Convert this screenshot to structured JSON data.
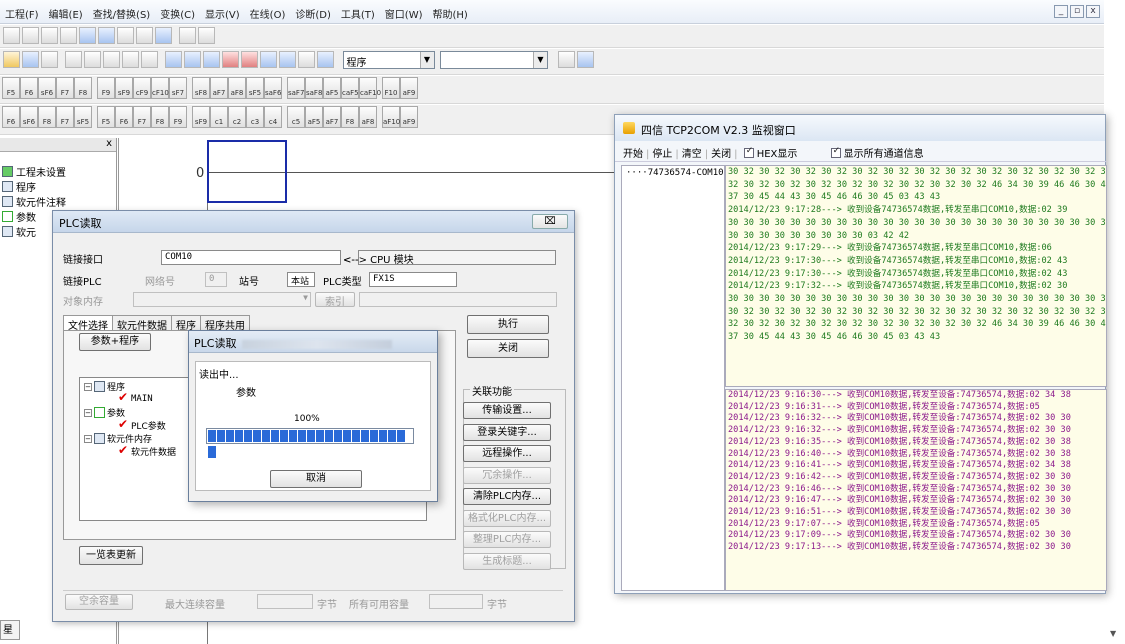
{
  "app": {
    "menu": [
      "工程(F)",
      "编辑(E)",
      "查找/替换(S)",
      "变换(C)",
      "显示(V)",
      "在线(O)",
      "诊断(D)",
      "工具(T)",
      "窗口(W)",
      "帮助(H)"
    ],
    "window_controls": [
      "_",
      "▫",
      "x"
    ],
    "combo_program": "程序",
    "combo_blank": "",
    "fkeys_row1": [
      "F5",
      "F6",
      "sF6",
      "F7",
      "F8",
      "F9",
      "sF9",
      "cF9",
      "cF10",
      "sF7",
      "sF8",
      "aF7",
      "aF8",
      "sF5",
      "saF6",
      "saF7",
      "saF8",
      "aF5",
      "caF5",
      "caF10",
      "F10",
      "aF9"
    ],
    "fkeys_row2": [
      "F6",
      "sF6",
      "F8",
      "F7",
      "sF5",
      "F5",
      "F6",
      "F7",
      "F8",
      "F9",
      "sF9",
      "c1",
      "c2",
      "c3",
      "c4",
      "c5",
      "aF5",
      "aF7",
      "F8",
      "aF8",
      "aF10",
      "aF9"
    ],
    "rung_step": "0",
    "bottom_tab": "星"
  },
  "left_panel": {
    "close_glyph": "x",
    "items": [
      {
        "label": "工程未设置"
      },
      {
        "label": "程序"
      },
      {
        "label": "软元件注释"
      },
      {
        "label": "参数"
      },
      {
        "label": "软元"
      }
    ]
  },
  "plc_dialog": {
    "title": "PLC读取",
    "close": "⌧",
    "link_interface_label": "链接接口",
    "link_interface_value": "COM10",
    "cpu_arrow": "<--> CPU 模块",
    "link_plc_label": "链接PLC",
    "network_label": "网络号",
    "network_value": "0",
    "station_label": "站号",
    "station_value": "本站",
    "plc_type_label": "PLC类型",
    "plc_type_value": "FX1S",
    "target_memory_label": "对象内存",
    "index_label": "索引",
    "tabs": [
      "文件选择",
      "软元件数据",
      "程序",
      "程序共用"
    ],
    "param_program_button": "参数+程序",
    "tree": {
      "program": "程序",
      "main": "MAIN",
      "params": "参数",
      "plc_params": "PLC参数",
      "device_memory": "软元件内存",
      "device_data": "软元件数据"
    },
    "list_update_button": "一览表更新",
    "execute_button": "执行",
    "close_button": "关闭",
    "related_title": "关联功能",
    "related_buttons": [
      "传输设置...",
      "登录关键字...",
      "远程操作...",
      "冗余操作...",
      "清除PLC内存...",
      "格式化PLC内存...",
      "整理PLC内存...",
      "生成标题..."
    ],
    "related_disabled": [
      false,
      false,
      false,
      true,
      false,
      true,
      true,
      true
    ],
    "free_capacity_button": "空余容量",
    "max_continuous_label": "最大连续容量",
    "bytes1": "字节",
    "all_available_label": "所有可用容量",
    "bytes2": "字节"
  },
  "progress_dialog": {
    "title": "PLC读取",
    "reading": "读出中...",
    "item": "参数",
    "percent": "100%",
    "progress": 1.0,
    "cancel": "取消"
  },
  "tcp_window": {
    "title": "四信 TCP2COM V2.3  监视窗口",
    "toolbar": [
      "开始",
      "停止",
      "清空",
      "关闭"
    ],
    "hex_label": "HEX显示",
    "show_all_label": "显示所有通道信息",
    "device": "74736574-COM10",
    "log_top": [
      "30 32 30 32 30 32 30 32 30 32 30 32 30 32 30 32 30 32 30 32 30 32 30 32 30 32",
      "32 30 32 30 32 30 32 30 32 30 32 30 32 30 32 30 32 46 34 30 39 46 46 30 42 46 34",
      "37 30 45 44 43 30 45 46 46 30 45 03 43 43",
      "2014/12/23 9:17:28---> 收到设备74736574数据,转发至串口COM10,数据:02 39",
      "30 30 30 30 30 30 30 30 30 30 30 30 30 30 30 30 30 30 30 30 30 30 30 30 30 30",
      "30 30 30 30 30 30 30 30 30 03 42 42",
      "2014/12/23 9:17:29---> 收到设备74736574数据,转发至串口COM10,数据:06",
      "2014/12/23 9:17:30---> 收到设备74736574数据,转发至串口COM10,数据:02 43",
      "2014/12/23 9:17:30---> 收到设备74736574数据,转发至串口COM10,数据:02 43",
      "2014/12/23 9:17:32---> 收到设备74736574数据,转发至串口COM10,数据:02 30",
      "30 30 30 30 30 30 30 30 30 30 30 30 30 30 30 30 30 30 30 30 30 30 30 30 30 30",
      "30 32 30 32 30 32 30 32 30 32 30 32 30 32 30 32 30 32 30 32 30 32 30 32 30 32",
      "32 30 32 30 32 30 32 30 32 30 32 30 32 30 32 30 32 46 34 30 39 46 46 30 42 46 34",
      "37 30 45 44 43 30 45 46 46 30 45 03 43 43"
    ],
    "log_bottom": [
      "2014/12/23 9:16:30---> 收到COM10数据,转发至设备:74736574,数据:02 34 38",
      "2014/12/23 9:16:31---> 收到COM10数据,转发至设备:74736574,数据:05",
      "2014/12/23 9:16:32---> 收到COM10数据,转发至设备:74736574,数据:02 30 30",
      "2014/12/23 9:16:32---> 收到COM10数据,转发至设备:74736574,数据:02 30 30",
      "2014/12/23 9:16:35---> 收到COM10数据,转发至设备:74736574,数据:02 30 38",
      "2014/12/23 9:16:40---> 收到COM10数据,转发至设备:74736574,数据:02 30 38",
      "2014/12/23 9:16:41---> 收到COM10数据,转发至设备:74736574,数据:02 34 38",
      "2014/12/23 9:16:42---> 收到COM10数据,转发至设备:74736574,数据:02 30 30",
      "2014/12/23 9:16:46---> 收到COM10数据,转发至设备:74736574,数据:02 30 30",
      "2014/12/23 9:16:47---> 收到COM10数据,转发至设备:74736574,数据:02 30 30",
      "2014/12/23 9:16:51---> 收到COM10数据,转发至设备:74736574,数据:02 30 30",
      "2014/12/23 9:17:07---> 收到COM10数据,转发至设备:74736574,数据:05",
      "2014/12/23 9:17:09---> 收到COM10数据,转发至设备:74736574,数据:02 30 30",
      "2014/12/23 9:17:13---> 收到COM10数据,转发至设备:74736574,数据:02 30 30"
    ]
  }
}
